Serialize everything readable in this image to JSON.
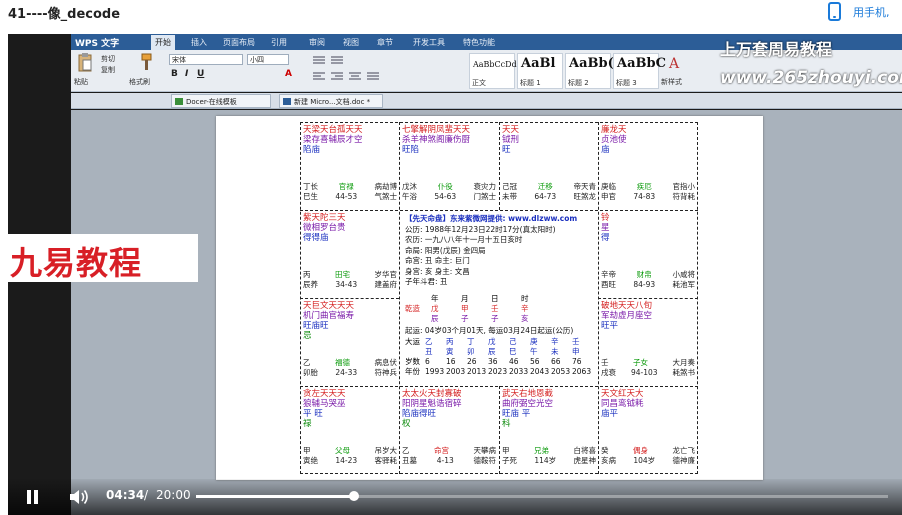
{
  "page": {
    "title": "41----像_decode",
    "phone_link": "用手机,"
  },
  "wps": {
    "brand": "WPS 文字",
    "menus": [
      "开始",
      "插入",
      "页面布局",
      "引用",
      "审阅",
      "视图",
      "章节",
      "开发工具",
      "特色功能"
    ],
    "ribbon": {
      "paste": "粘贴",
      "cut": "剪切",
      "copy": "复制",
      "format_painter": "格式刷",
      "font": "宋体",
      "size": "小四",
      "styles": [
        {
          "sample": "AaBbCcDd",
          "name": "正文"
        },
        {
          "sample": "AaBl",
          "name": "标题 1"
        },
        {
          "sample": "AaBb(",
          "name": "标题 2"
        },
        {
          "sample": "AaBbC",
          "name": "标题 3"
        }
      ],
      "new_style": "新样式"
    },
    "tabs": [
      {
        "label": "Docer-在线模板"
      },
      {
        "label": "新建 Micro...文档.doc *"
      }
    ]
  },
  "chart": {
    "cells": [
      {
        "id": "r0c0",
        "lines": [
          {
            "t": "天梁天台孤天天",
            "c": "red"
          },
          {
            "t": "梁存喜辅辰才空",
            "c": "purple"
          },
          {
            "t": "陷庙",
            "c": "blue"
          }
        ],
        "foot": {
          "a": "丁长",
          "mid": "官禄",
          "b": "病劫博",
          "a2": "巳生",
          "mid2": "44-53",
          "b2": "气煞士"
        }
      },
      {
        "id": "r0c1",
        "lines": [
          {
            "t": "七擎解阴凤蜚天天",
            "c": "red"
          },
          {
            "t": "杀羊神煞阁廉伤厨",
            "c": "purple"
          },
          {
            "t": "旺陷",
            "c": "blue"
          }
        ],
        "foot": {
          "a": "戊沐",
          "mid": "仆役",
          "b": "衰灾力",
          "a2": "午浴",
          "mid2": "54-63",
          "b2": "门煞士"
        }
      },
      {
        "id": "r0c2",
        "lines": [
          {
            "t": "天天",
            "c": "red"
          },
          {
            "t": "钺刑",
            "c": "purple"
          },
          {
            "t": "旺",
            "c": "blue"
          }
        ],
        "foot": {
          "a": "己冠",
          "mid": "迁移",
          "b": "帝天青",
          "a2": "未带",
          "mid2": "64-73",
          "b2": "旺煞龙"
        }
      },
      {
        "id": "r0c3",
        "lines": [
          {
            "t": "廉龙天",
            "c": "red"
          },
          {
            "t": "贞池使",
            "c": "purple"
          },
          {
            "t": "庙",
            "c": "blue"
          }
        ],
        "foot": {
          "a": "庚临",
          "mid": "疾厄",
          "b": "官指小",
          "a2": "申官",
          "mid2": "74-83",
          "b2": "符背耗"
        }
      },
      {
        "id": "r1c0",
        "lines": [
          {
            "t": "紫天陀三天",
            "c": "red"
          },
          {
            "t": "微相罗台贵",
            "c": "purple"
          },
          {
            "t": "得得庙",
            "c": "blue"
          }
        ],
        "foot": {
          "a": "丙",
          "mid": "田宅",
          "b": "岁华官",
          "a2": "辰养",
          "mid2": "34-43",
          "b2": "建盖府"
        }
      },
      {
        "id": "r1c3",
        "lines": [
          {
            "t": "铃",
            "c": "red"
          },
          {
            "t": "星",
            "c": "purple"
          },
          {
            "t": "得",
            "c": "blue"
          }
        ],
        "foot": {
          "a": "辛帝",
          "mid": "财帛",
          "b": "小咸将",
          "a2": "酉旺",
          "mid2": "84-93",
          "b2": "耗池军"
        }
      },
      {
        "id": "r2c0",
        "lines": [
          {
            "t": "天巨文天天天",
            "c": "red"
          },
          {
            "t": "机门曲官福寿",
            "c": "purple"
          },
          {
            "t": "旺庙旺",
            "c": "blue"
          },
          {
            "t": "忌",
            "c": "green"
          }
        ],
        "foot": {
          "a": "乙",
          "mid": "福德",
          "b": "病息伏",
          "a2": "卯胎",
          "mid2": "24-33",
          "b2": "符神兵"
        }
      },
      {
        "id": "r2c3",
        "lines": [
          {
            "t": "破地天天八旬",
            "c": "red"
          },
          {
            "t": "军劫虚月座空",
            "c": "purple"
          },
          {
            "t": "旺平",
            "c": "blue"
          }
        ],
        "foot": {
          "a": "壬",
          "mid": "子女",
          "b": "大月奏",
          "a2": "戌衰",
          "mid2": "94-103",
          "b2": "耗煞书"
        }
      },
      {
        "id": "r3c0",
        "lines": [
          {
            "t": "贪左天天天",
            "c": "red"
          },
          {
            "t": "狼辅马哭巫",
            "c": "purple"
          },
          {
            "t": "平  旺",
            "c": "blue"
          },
          {
            "t": "禄",
            "c": "green"
          }
        ],
        "foot": {
          "a": "甲",
          "mid": "父母",
          "b": "吊岁大",
          "a2": "寅绝",
          "mid2": "14-23",
          "b2": "客驿耗"
        }
      },
      {
        "id": "r3c1",
        "lines": [
          {
            "t": "太太火天封寡破",
            "c": "red"
          },
          {
            "t": "阳阴星魁诰宿碎",
            "c": "purple"
          },
          {
            "t": "陷庙得旺",
            "c": "blue"
          },
          {
            "t": "  权",
            "c": "green"
          }
        ],
        "foot": {
          "a": "乙",
          "mid": "命宫",
          "b": "天攀病",
          "a2": "丑墓",
          "mid2": "4-13",
          "b2": "德鞍符",
          "red": true
        }
      },
      {
        "id": "r3c2",
        "lines": [
          {
            "t": "武天右地恩截",
            "c": "red"
          },
          {
            "t": "曲府弼空光空",
            "c": "purple"
          },
          {
            "t": "旺庙  平",
            "c": "blue"
          },
          {
            "t": "    科",
            "c": "green"
          }
        ],
        "foot": {
          "a": "甲",
          "mid": "兄弟",
          "b": "白将喜",
          "a2": "子死",
          "mid2": "114岁",
          "b2": "虎星神"
        }
      },
      {
        "id": "r3c3",
        "lines": [
          {
            "t": "天文红天大",
            "c": "red"
          },
          {
            "t": "同昌鸾钺耗",
            "c": "purple"
          },
          {
            "t": "庙平",
            "c": "blue"
          }
        ],
        "foot": {
          "a": "癸",
          "mid": "偶身",
          "b": "龙亡飞",
          "a2": "亥病",
          "mid2": "104岁",
          "b2": "德神廉",
          "red": true
        }
      }
    ],
    "center": {
      "header": "【先天命盘】东来紫微网提供: www.dlzww.com",
      "lines": [
        "公历: 1988年12月23日22时17分(真太阳时)",
        "农历: 一九八八年十一月十五日亥时",
        "命局: 阳男(戊辰)  金四局",
        "命宫: 丑    命主: 巨门",
        "身宫: 亥    身主: 文昌",
        "子年斗君: 丑"
      ],
      "pillar_labels": [
        "年",
        "月",
        "日",
        "时"
      ],
      "qian": "乾造",
      "heaven": [
        "戊",
        "甲",
        "壬",
        "辛"
      ],
      "earth": [
        "辰",
        "子",
        "子",
        "亥"
      ],
      "qiyun": "起运: 04岁03个月01天, 每运03月24日起运(公历)",
      "dayun_label": "大运",
      "dayun_top": [
        "乙",
        "丙",
        "丁",
        "戊",
        "己",
        "庚",
        "辛",
        "壬"
      ],
      "dayun_bottom": [
        "丑",
        "寅",
        "卯",
        "辰",
        "巳",
        "午",
        "未",
        "申"
      ],
      "age_label": "岁数",
      "ages": [
        "6",
        "16",
        "26",
        "36",
        "46",
        "56",
        "66",
        "76"
      ],
      "year_label": "年份",
      "years": [
        "1993",
        "2003",
        "2013",
        "2023",
        "2033",
        "2043",
        "2053",
        "2063"
      ]
    }
  },
  "watermark": {
    "top": "上万套周易教程",
    "url": "www.265zhouyi.com",
    "logo": "九易教程"
  },
  "player": {
    "current": "04:34",
    "separator": "/",
    "total": "20:00",
    "progress": 0.228
  },
  "colors": {
    "wps_blue": "#2c5d97",
    "star_red": "#d42020",
    "star_purple": "#7a1aa8",
    "star_blue": "#1a2fbf",
    "star_green": "#0a8a0a",
    "link_blue": "#1a7ad9"
  }
}
